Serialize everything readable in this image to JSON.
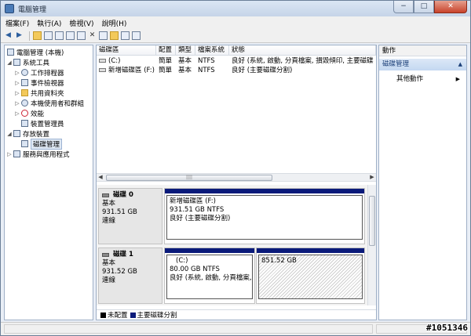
{
  "window": {
    "title": "電腦管理",
    "min": "−",
    "max": "□",
    "close": "✕"
  },
  "menu": [
    "檔案(F)",
    "執行(A)",
    "檢視(V)",
    "說明(H)"
  ],
  "toolbar": {
    "back": "◀",
    "forward": "▶",
    "delete": "✕"
  },
  "tree": {
    "root": "電腦管理 (本機)",
    "system_tools": "系統工具",
    "task_scheduler": "工作排程器",
    "event_viewer": "事件檢視器",
    "shared_folders": "共用資料夾",
    "local_users": "本機使用者和群組",
    "performance": "效能",
    "device_manager": "裝置管理員",
    "storage": "存放裝置",
    "disk_management": "磁碟管理",
    "services": "服務與應用程式"
  },
  "volumes": {
    "headers": [
      "磁碟區",
      "配置",
      "類型",
      "檔案系統",
      "狀態"
    ],
    "rows": [
      [
        "(C:)",
        "簡單",
        "基本",
        "NTFS",
        "良好 (系統, 啟動, 分頁檔案, 損毀傾印, 主要磁碟"
      ],
      [
        "新增磁碟區 (F:)",
        "簡單",
        "基本",
        "NTFS",
        "良好 (主要磁碟分割)"
      ]
    ]
  },
  "disks": [
    {
      "name": "磁碟 0",
      "type": "基本",
      "size": "931.51 GB",
      "status": "連線",
      "partitions": [
        {
          "label": "新增磁碟區 (F:)",
          "size": "931.51 GB NTFS",
          "status": "良好 (主要磁碟分割)"
        }
      ]
    },
    {
      "name": "磁碟 1",
      "type": "基本",
      "size": "931.52 GB",
      "status": "連線",
      "partitions": [
        {
          "label": "(C:)",
          "size": "80.00 GB NTFS",
          "status": "良好 (系統, 啟動, 分頁檔案,"
        },
        {
          "label": "",
          "size": "851.52 GB",
          "status": ""
        }
      ]
    }
  ],
  "legend": {
    "unallocated": "未配置",
    "primary": "主要磁碟分割",
    "unallocated_color": "#000000",
    "primary_color": "#0a1a7a"
  },
  "actions": {
    "header": "動作",
    "selected": "磁碟管理",
    "more": "其他動作"
  },
  "watermark": "#1051346"
}
